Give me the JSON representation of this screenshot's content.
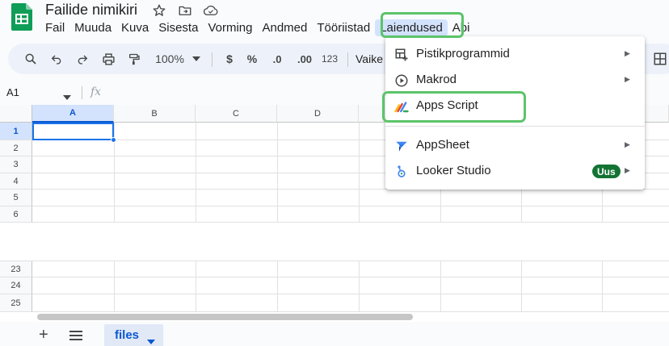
{
  "document": {
    "title": "Failide nimikiri"
  },
  "menubar": {
    "items": [
      "Fail",
      "Muuda",
      "Kuva",
      "Sisesta",
      "Vorming",
      "Andmed",
      "Tööriistad",
      "Laiendused",
      "Abi"
    ],
    "active": "Laiendused"
  },
  "toolbar": {
    "zoom": "100%",
    "currency": "$",
    "percent": "%",
    "decrease_decimal": ".0",
    "increase_decimal": ".00",
    "number_format": "123",
    "font_truncated": "Vaike"
  },
  "formula_bar": {
    "name_box": "A1",
    "fx_label": "fx"
  },
  "grid": {
    "columns": [
      "A",
      "B",
      "C",
      "D"
    ],
    "rows_top": [
      "1",
      "2",
      "3",
      "4",
      "5",
      "6"
    ],
    "rows_bottom": [
      "23",
      "24",
      "25"
    ],
    "selected_cell": "A1"
  },
  "sheets": {
    "tabs": [
      {
        "label": "files",
        "active": true
      }
    ]
  },
  "extensions_menu": {
    "items": [
      {
        "label": "Pistikprogrammid",
        "icon": "addons-icon",
        "submenu": true
      },
      {
        "label": "Makrod",
        "icon": "play-circle-icon",
        "submenu": true
      },
      {
        "label": "Apps Script",
        "icon": "apps-script-icon",
        "submenu": false
      },
      {
        "label": "AppSheet",
        "icon": "appsheet-icon",
        "submenu": true
      },
      {
        "label": "Looker Studio",
        "icon": "looker-studio-icon",
        "submenu": true,
        "badge": "Uus"
      }
    ],
    "submenu_arrow": "▶"
  },
  "colors": {
    "highlight": "#5cc46a",
    "accent": "#0b57d0",
    "badge": "#137333"
  }
}
